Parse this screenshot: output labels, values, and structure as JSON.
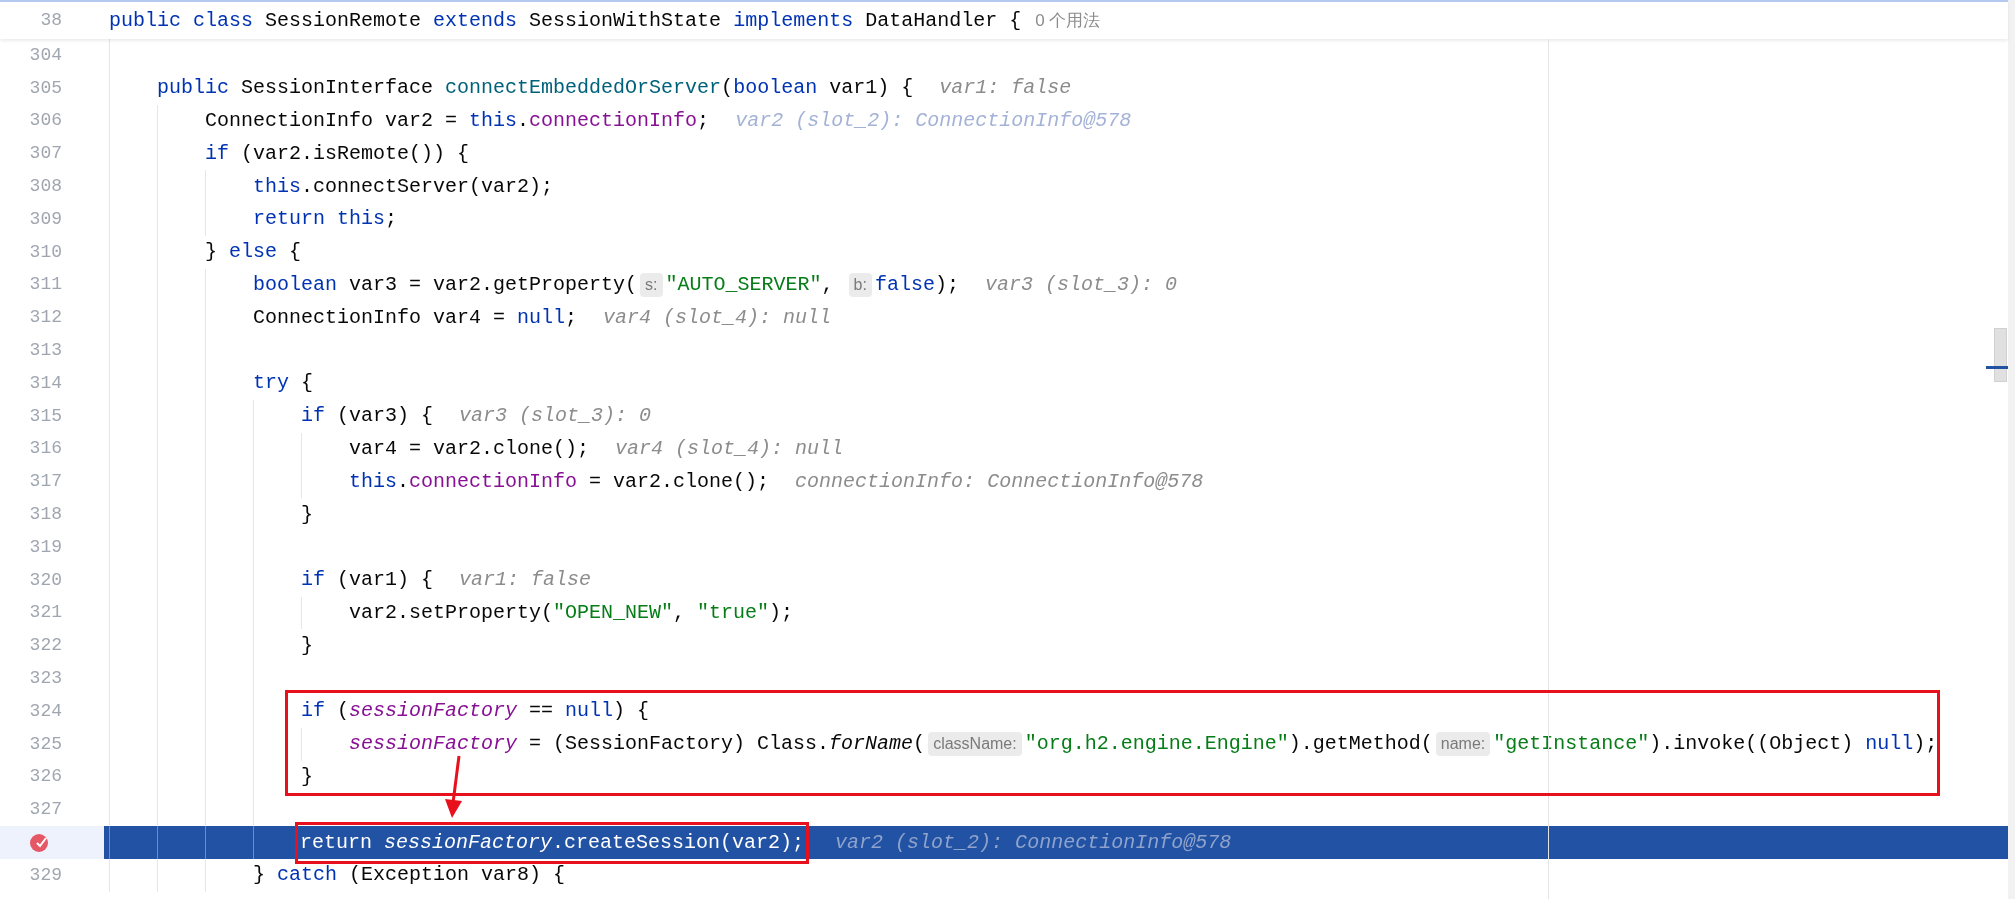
{
  "sticky_line": {
    "number": "38",
    "tokens": [
      {
        "kind": "kw",
        "text": "public class"
      },
      {
        "kind": "plain",
        "text": " SessionRemote "
      },
      {
        "kind": "kw",
        "text": "extends"
      },
      {
        "kind": "plain",
        "text": " SessionWithState "
      },
      {
        "kind": "kw",
        "text": "implements"
      },
      {
        "kind": "plain",
        "text": " DataHandler {"
      }
    ],
    "usages": "0 个用法"
  },
  "lines": [
    {
      "number": "304",
      "current": false,
      "breakpoint": false
    },
    {
      "number": "305",
      "current": false,
      "breakpoint": false,
      "tokens": [
        {
          "kind": "kw",
          "text": "    public"
        },
        {
          "kind": "plain",
          "text": " SessionInterface "
        },
        {
          "kind": "method",
          "text": "connectEmbeddedOrServer"
        },
        {
          "kind": "plain",
          "text": "("
        },
        {
          "kind": "kw",
          "text": "boolean"
        },
        {
          "kind": "plain",
          "text": " var1) {"
        },
        {
          "kind": "hint",
          "text": "var1: false"
        }
      ]
    },
    {
      "number": "306",
      "current": false,
      "breakpoint": false,
      "tokens": [
        {
          "kind": "plain",
          "text": "        ConnectionInfo var2 = "
        },
        {
          "kind": "kw",
          "text": "this"
        },
        {
          "kind": "plain",
          "text": "."
        },
        {
          "kind": "field",
          "text": "connectionInfo"
        },
        {
          "kind": "plain",
          "text": ";"
        },
        {
          "kind": "hint-changed",
          "text": "var2 (slot_2): ConnectionInfo@578"
        }
      ]
    },
    {
      "number": "307",
      "current": false,
      "breakpoint": false,
      "tokens": [
        {
          "kind": "kw",
          "text": "        if"
        },
        {
          "kind": "plain",
          "text": " (var2.isRemote()) {"
        }
      ]
    },
    {
      "number": "308",
      "current": false,
      "breakpoint": false,
      "tokens": [
        {
          "kind": "kw",
          "text": "            this"
        },
        {
          "kind": "plain",
          "text": ".connectServer(var2);"
        }
      ]
    },
    {
      "number": "309",
      "current": false,
      "breakpoint": false,
      "tokens": [
        {
          "kind": "kw",
          "text": "            return this"
        },
        {
          "kind": "plain",
          "text": ";"
        }
      ]
    },
    {
      "number": "310",
      "current": false,
      "breakpoint": false,
      "tokens": [
        {
          "kind": "plain",
          "text": "        } "
        },
        {
          "kind": "kw",
          "text": "else"
        },
        {
          "kind": "plain",
          "text": " {"
        }
      ]
    },
    {
      "number": "311",
      "current": false,
      "breakpoint": false,
      "tokens": [
        {
          "kind": "kw",
          "text": "            boolean"
        },
        {
          "kind": "plain",
          "text": " var3 = var2.getProperty("
        },
        {
          "kind": "param",
          "text": "s:"
        },
        {
          "kind": "string",
          "text": "\"AUTO_SERVER\""
        },
        {
          "kind": "plain",
          "text": ", "
        },
        {
          "kind": "param",
          "text": "b:"
        },
        {
          "kind": "kw",
          "text": "false"
        },
        {
          "kind": "plain",
          "text": ");"
        },
        {
          "kind": "hint",
          "text": "var3 (slot_3): 0"
        }
      ]
    },
    {
      "number": "312",
      "current": false,
      "breakpoint": false,
      "tokens": [
        {
          "kind": "plain",
          "text": "            ConnectionInfo var4 = "
        },
        {
          "kind": "kw",
          "text": "null"
        },
        {
          "kind": "plain",
          "text": ";"
        },
        {
          "kind": "hint",
          "text": "var4 (slot_4): null"
        }
      ]
    },
    {
      "number": "313",
      "current": false,
      "breakpoint": false
    },
    {
      "number": "314",
      "current": false,
      "breakpoint": false,
      "tokens": [
        {
          "kind": "kw",
          "text": "            try"
        },
        {
          "kind": "plain",
          "text": " {"
        }
      ]
    },
    {
      "number": "315",
      "current": false,
      "breakpoint": false,
      "tokens": [
        {
          "kind": "kw",
          "text": "                if"
        },
        {
          "kind": "plain",
          "text": " (var3) {"
        },
        {
          "kind": "hint",
          "text": "var3 (slot_3): 0"
        }
      ]
    },
    {
      "number": "316",
      "current": false,
      "breakpoint": false,
      "tokens": [
        {
          "kind": "plain",
          "text": "                    var4 = var2.clone();"
        },
        {
          "kind": "hint",
          "text": "var4 (slot_4): null"
        }
      ]
    },
    {
      "number": "317",
      "current": false,
      "breakpoint": false,
      "tokens": [
        {
          "kind": "kw",
          "text": "                    this"
        },
        {
          "kind": "plain",
          "text": "."
        },
        {
          "kind": "field",
          "text": "connectionInfo"
        },
        {
          "kind": "plain",
          "text": " = var2.clone();"
        },
        {
          "kind": "hint",
          "text": "connectionInfo: ConnectionInfo@578"
        }
      ]
    },
    {
      "number": "318",
      "current": false,
      "breakpoint": false,
      "tokens": [
        {
          "kind": "plain",
          "text": "                }"
        }
      ]
    },
    {
      "number": "319",
      "current": false,
      "breakpoint": false
    },
    {
      "number": "320",
      "current": false,
      "breakpoint": false,
      "tokens": [
        {
          "kind": "kw",
          "text": "                if"
        },
        {
          "kind": "plain",
          "text": " (var1) {"
        },
        {
          "kind": "hint",
          "text": "var1: false"
        }
      ]
    },
    {
      "number": "321",
      "current": false,
      "breakpoint": false,
      "tokens": [
        {
          "kind": "plain",
          "text": "                    var2.setProperty("
        },
        {
          "kind": "string",
          "text": "\"OPEN_NEW\""
        },
        {
          "kind": "plain",
          "text": ", "
        },
        {
          "kind": "string",
          "text": "\"true\""
        },
        {
          "kind": "plain",
          "text": ");"
        }
      ]
    },
    {
      "number": "322",
      "current": false,
      "breakpoint": false,
      "tokens": [
        {
          "kind": "plain",
          "text": "                }"
        }
      ]
    },
    {
      "number": "323",
      "current": false,
      "breakpoint": false
    },
    {
      "number": "324",
      "current": false,
      "breakpoint": false,
      "tokens": [
        {
          "kind": "kw",
          "text": "                if"
        },
        {
          "kind": "plain",
          "text": " ("
        },
        {
          "kind": "static",
          "text": "sessionFactory"
        },
        {
          "kind": "plain",
          "text": " == "
        },
        {
          "kind": "kw",
          "text": "null"
        },
        {
          "kind": "plain",
          "text": ") {"
        }
      ]
    },
    {
      "number": "325",
      "current": false,
      "breakpoint": false,
      "tokens": [
        {
          "kind": "static",
          "text": "                    sessionFactory"
        },
        {
          "kind": "plain",
          "text": " = (SessionFactory) Class."
        },
        {
          "kind": "static-call",
          "text": "forName"
        },
        {
          "kind": "plain",
          "text": "("
        },
        {
          "kind": "param",
          "text": "className:"
        },
        {
          "kind": "string",
          "text": "\"org.h2.engine.Engine\""
        },
        {
          "kind": "plain",
          "text": ").getMethod("
        },
        {
          "kind": "param",
          "text": "name:"
        },
        {
          "kind": "string",
          "text": "\"getInstance\""
        },
        {
          "kind": "plain",
          "text": ").invoke((Object) "
        },
        {
          "kind": "kw",
          "text": "null"
        },
        {
          "kind": "plain",
          "text": ");"
        }
      ]
    },
    {
      "number": "326",
      "current": false,
      "breakpoint": false,
      "tokens": [
        {
          "kind": "plain",
          "text": "                }"
        }
      ]
    },
    {
      "number": "327",
      "current": false,
      "breakpoint": false
    },
    {
      "current": true,
      "breakpoint": true,
      "boxed": true,
      "tokens": [
        {
          "kind": "kw",
          "text": "                return"
        },
        {
          "kind": "static",
          "text": " sessionFactory"
        },
        {
          "kind": "plain",
          "text": ".createSession(var2);"
        },
        {
          "kind": "hint",
          "text": "var2 (slot_2): ConnectionInfo@578"
        }
      ]
    },
    {
      "number": "329",
      "current": false,
      "breakpoint": false,
      "boxed": false,
      "tokens": [
        {
          "kind": "plain",
          "text": "            } "
        },
        {
          "kind": "kw",
          "text": "catch"
        },
        {
          "kind": "plain",
          "text": " (Exception var8) {"
        }
      ]
    }
  ]
}
